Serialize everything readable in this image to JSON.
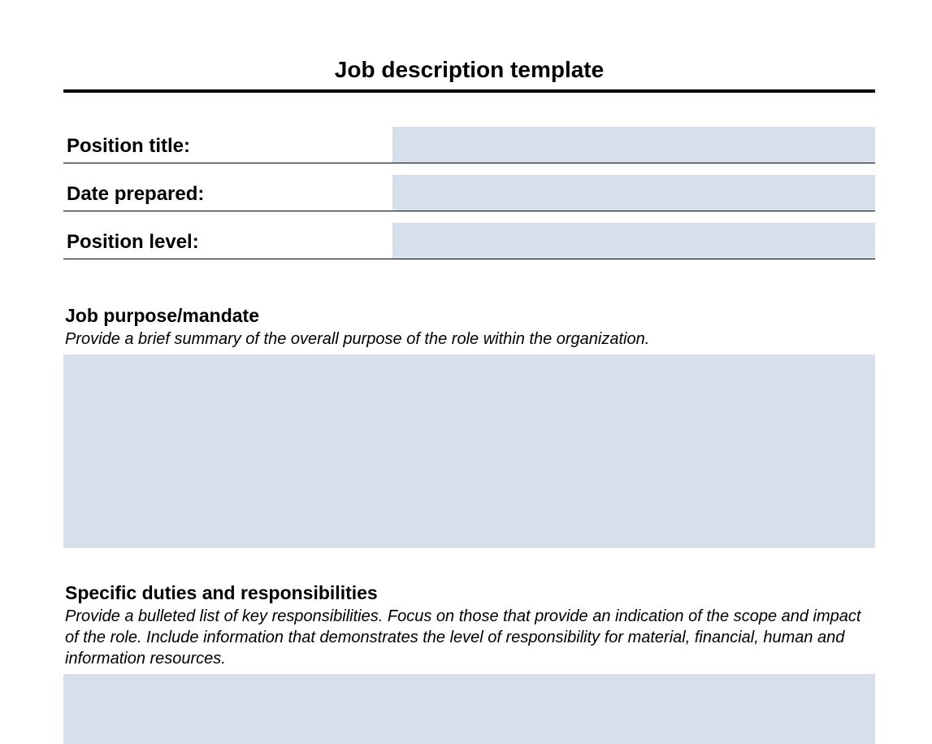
{
  "title": "Job description template",
  "fields": {
    "position_title": {
      "label": "Position title:",
      "value": ""
    },
    "date_prepared": {
      "label": "Date prepared:",
      "value": ""
    },
    "position_level": {
      "label": "Position level:",
      "value": ""
    }
  },
  "sections": {
    "purpose": {
      "heading": "Job purpose/mandate",
      "desc": "Provide a brief summary of the overall purpose of the role within the organization.",
      "value": ""
    },
    "duties": {
      "heading": "Specific duties and responsibilities",
      "desc": "Provide a bulleted list of key responsibilities. Focus on those that provide an indication of the scope and impact of the role. Include information that demonstrates the level of responsibility for material, financial, human and information resources.",
      "value": ""
    }
  }
}
